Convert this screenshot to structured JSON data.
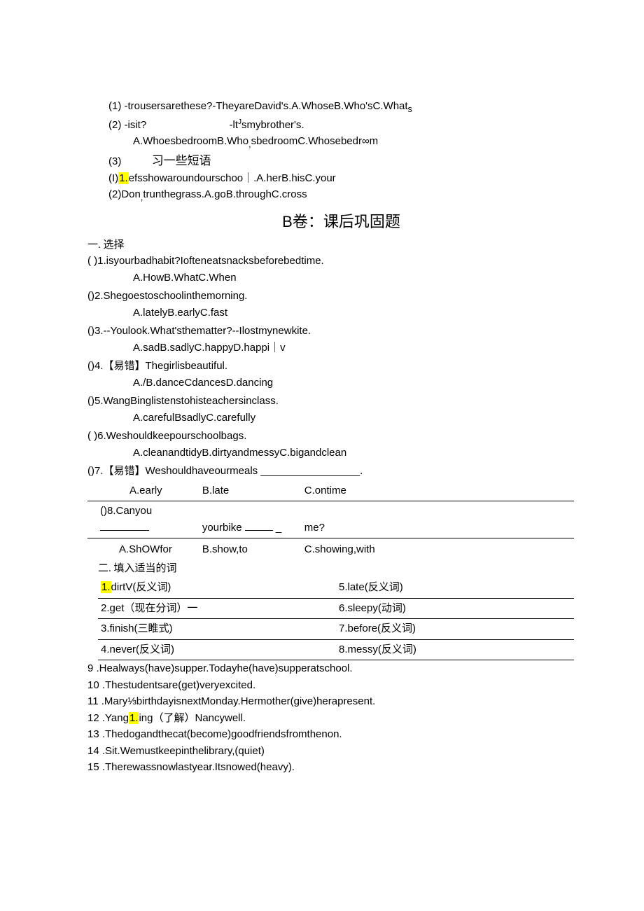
{
  "top": {
    "l1": "(1)   -trousersarethese?-TheyareDavid's.A.WhoseB.Who'sC.What",
    "l1_tail": "s",
    "l2a": "(2)   -isit?",
    "l2b": "-lt",
    "l2c": "smybrother's.",
    "l3": "A.WhoesbedroomB.Who",
    "l3b": "sbedroomC.Whosebedr∞m",
    "l4a": "(3)",
    "l4b": "习一些短语",
    "l5_pre": "(I)",
    "l5_hl": "1.",
    "l5_rest": "efsshowaroundourschoo｜.A.herB.hisC.your",
    "l6": "(2)Don",
    "l6b": "trunthegrass.A.goB.throughC.cross"
  },
  "title": "B卷：课后巩固题",
  "sec1_head": "一. 选择",
  "sec1": {
    "q1a": "(       )1.isyourbadhabit?Iofteneatsnacksbeforebedtime.",
    "q1b": "A.HowB.WhatC.When",
    "q2a": "()2.Shegoestoschoolinthemorning.",
    "q2b": "A.latelyB.earlyC.fast",
    "q3a": "()3.--Youlook.What'sthematter?--Ilostmynewkite.",
    "q3b": "A.sadB.sadlyC.happyD.happi｜v",
    "q4a": "()4.【易错】Thegirlisbeautiful.",
    "q4b": "A./B.danceCdancesD.dancing",
    "q5a": "()5.WangBinglistenstohisteachersinclass.",
    "q5b": "A.carefulBsadlyC.carefully",
    "q6a": "(       )6.Weshouldkeepourschoolbags.",
    "q6b": "A.cleanandtidyB.dirtyandmessyC.bigandclean",
    "q7a": "()7.【易错】Weshouldhaveourmeals  _________________."
  },
  "tbl1": {
    "r1c1": "A.early",
    "r1c2": "B.late",
    "r1c3": "C.ontime",
    "r2c1": "()8.Canyou ",
    "r2c2": "yourbike ",
    "r2c3": "me?",
    "r3c1": "A.ShOWfor",
    "r3c2": "B.show,to",
    "r3c3": "C.showing,with"
  },
  "sec2_head": "二. 填入适当的词",
  "tbl2": {
    "r1l_hl": "1.",
    "r1l": "dirtV(反义词)",
    "r1r": "5.late(反义词)",
    "r2l": "2.get（现在分词）一",
    "r2r": "6.sleepy(动词)",
    "r3l": "3.finish(三睢式)",
    "r3r": "7.before(反义词)",
    "r4l": "4.never(反义词)",
    "r4r": "8.messy(反义词)"
  },
  "sec3": {
    "l9": "9    .Healways(have)supper.Todayhe(have)supperatschool.",
    "l10": "10    .Thestudentsare(get)veryexcited.",
    "l11": "11    .Mary⅓birthdayisnextMonday.Hermother(give)herapresent.",
    "l12a": "12    .Yang",
    "l12hl": "1.",
    "l12b": "ing（了解）Nancywell.",
    "l13": "13    .Thedogandthecat(become)goodfriendsfromthenon.",
    "l14": "14    .Sit.Wemustkeepinthelibrary,(quiet)",
    "l15": "15    .Therewassnowlastyear.Itsnowed(heavy)."
  }
}
